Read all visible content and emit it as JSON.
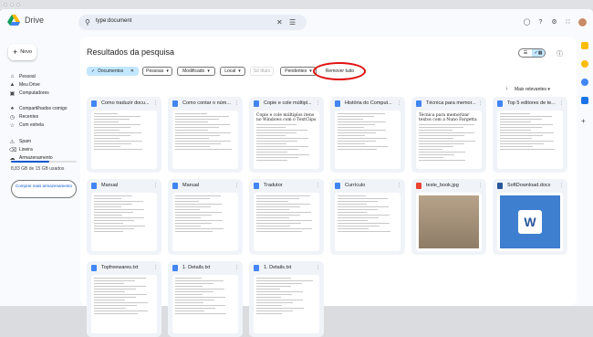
{
  "app": {
    "name": "Drive"
  },
  "search": {
    "query": "type:document"
  },
  "sidebar": {
    "new_label": "Novo",
    "items": [
      {
        "label": "Pessoal",
        "icon": "home-icon"
      },
      {
        "label": "Meu Drive",
        "icon": "drive-icon"
      },
      {
        "label": "Computadores",
        "icon": "computer-icon"
      },
      {
        "label": "Compartilhados comigo",
        "icon": "shared-icon"
      },
      {
        "label": "Recentes",
        "icon": "clock-icon"
      },
      {
        "label": "Com estrela",
        "icon": "star-icon"
      },
      {
        "label": "Spam",
        "icon": "spam-icon"
      },
      {
        "label": "Lixeira",
        "icon": "trash-icon"
      },
      {
        "label": "Armazenamento",
        "icon": "cloud-icon"
      }
    ],
    "storage_text": "8,83 GB de 15 GB usados",
    "storage_fraction": 0.59,
    "buy_label": "Comprar mais armazenamento"
  },
  "main": {
    "title": "Resultados da pesquisa",
    "filters": {
      "type": "Documentos",
      "people": "Pessoas",
      "modified": "Modificado",
      "location": "Local",
      "title_only": "Só título",
      "pending": "Pendentes",
      "clear": "Remover tudo"
    },
    "sort_label": "Mais relevantes"
  },
  "files": [
    {
      "name": "Como traduzir docu...",
      "kind": "doc",
      "thumb_title": "",
      "thumb_heading": ""
    },
    {
      "name": "Como contar o núm...",
      "kind": "doc",
      "thumb_title": "",
      "thumb_heading": ""
    },
    {
      "name": "Copie e cole múltipl...",
      "kind": "doc",
      "thumb_title": "Copie e cole múltiplos itens no Windows com o TextClips",
      "thumb_heading": ""
    },
    {
      "name": "História do Comput...",
      "kind": "doc",
      "thumb_title": "",
      "thumb_heading": ""
    },
    {
      "name": "Técnica para memor...",
      "kind": "doc",
      "thumb_title": "Técnica para memorizar textos com a Nuno Fargetta",
      "thumb_heading": ""
    },
    {
      "name": "Top 5 editores de te...",
      "kind": "doc",
      "thumb_title": "",
      "thumb_heading": ""
    },
    {
      "name": "Manual",
      "kind": "doc",
      "thumb_title": "",
      "thumb_heading": ""
    },
    {
      "name": "Manual",
      "kind": "doc",
      "thumb_title": "",
      "thumb_heading": ""
    },
    {
      "name": "Tradutor",
      "kind": "doc",
      "thumb_title": "",
      "thumb_heading": ""
    },
    {
      "name": "Currículo",
      "kind": "doc",
      "thumb_title": "",
      "thumb_heading": ""
    },
    {
      "name": "teste_book.jpg",
      "kind": "image",
      "thumb_title": "",
      "thumb_heading": ""
    },
    {
      "name": "SoftDownload.docx",
      "kind": "word",
      "thumb_title": "",
      "thumb_heading": ""
    },
    {
      "name": "Topfreewares.txt",
      "kind": "txt",
      "thumb_title": "",
      "thumb_heading": ""
    },
    {
      "name": "1. Details.txt",
      "kind": "txt",
      "thumb_title": "",
      "thumb_heading": ""
    },
    {
      "name": "1. Details.txt",
      "kind": "txt",
      "thumb_title": "",
      "thumb_heading": ""
    }
  ],
  "colors": {
    "doc": "#4285f4",
    "image": "#ea4335",
    "txt": "#4285f4",
    "word": "#2b579a",
    "accent": "#0b57d0",
    "selected_chip": "#c2e7ff",
    "annotation_circle": "#e01010"
  }
}
